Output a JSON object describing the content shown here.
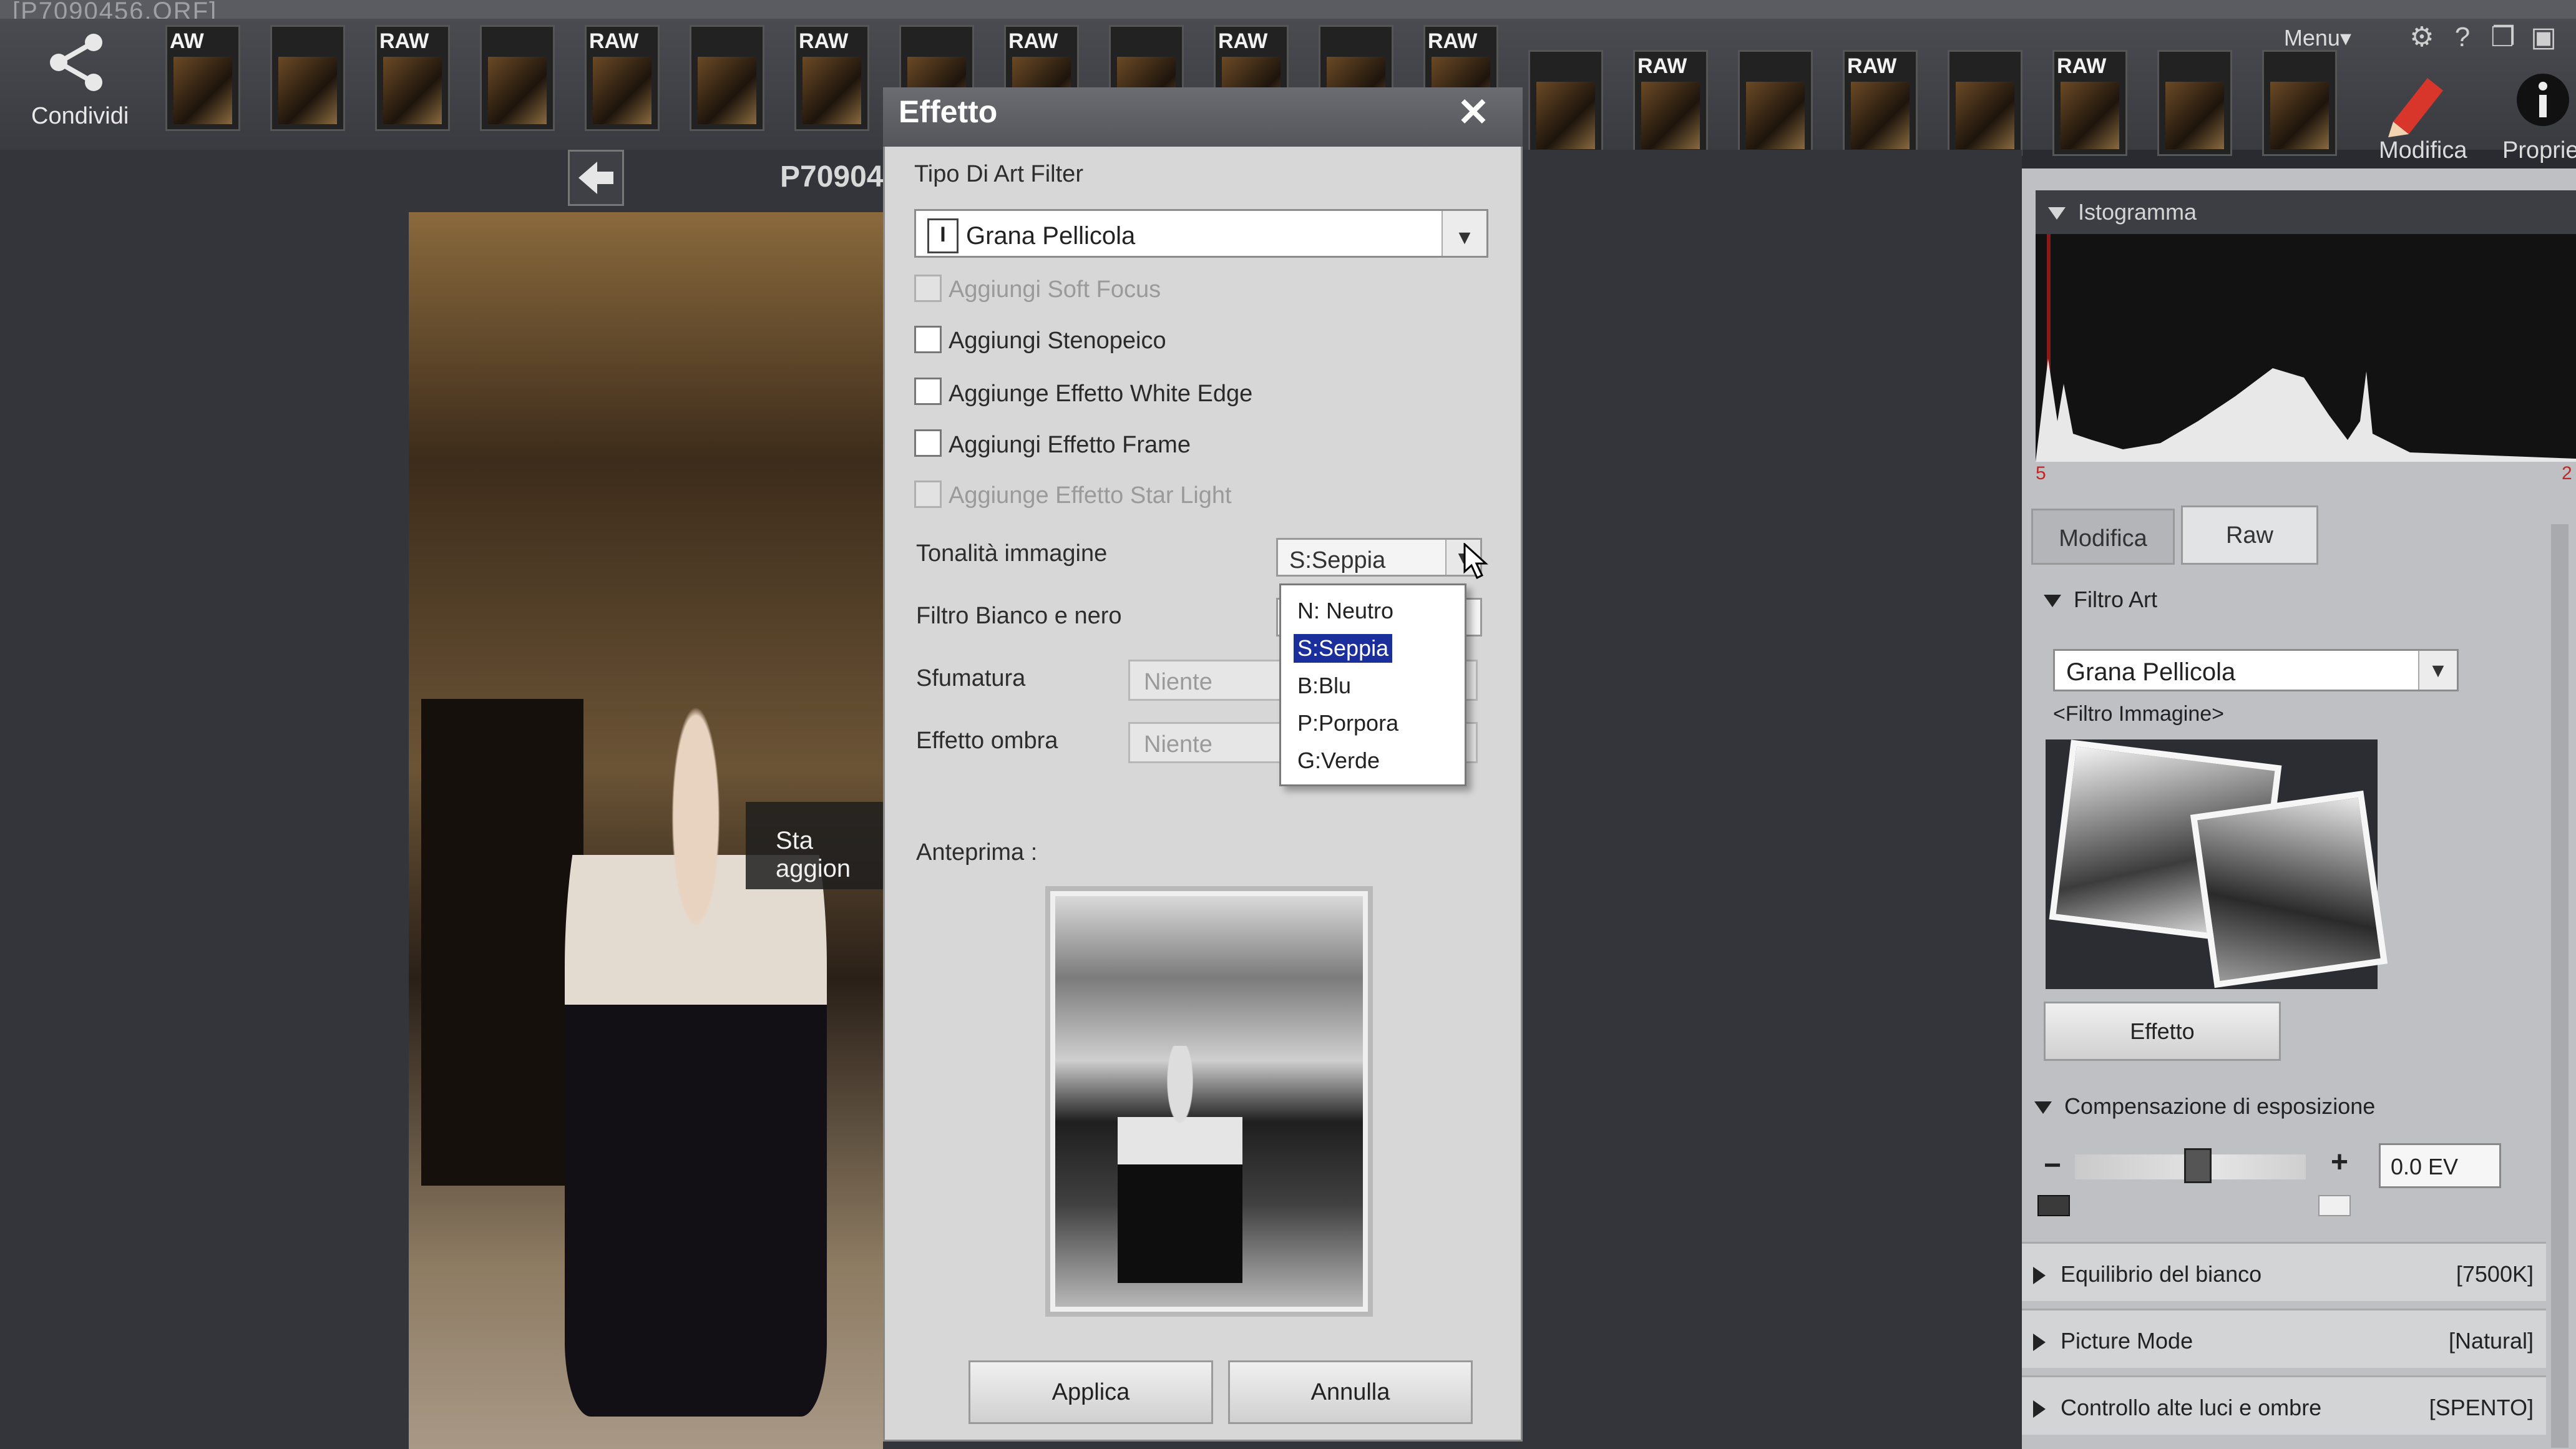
{
  "window": {
    "title_fragment": "[P7090456.ORF]"
  },
  "toolbar": {
    "share_label": "Condividi",
    "menu_label": "Menu▾",
    "edit_label": "Modifica",
    "properties_label": "Propriet",
    "thumbnails": [
      "AW",
      "",
      "RAW",
      "",
      "RAW",
      "",
      "RAW",
      "",
      "RAW",
      "",
      "RAW",
      "",
      "RAW",
      "",
      "RAW",
      "",
      "RAW",
      "",
      "RAW",
      "",
      ""
    ]
  },
  "viewer": {
    "filename": "P70904",
    "loading_text": "Sta aggion"
  },
  "dialog": {
    "title": "Effetto",
    "close_glyph": "✕",
    "art_filter_type_label": "Tipo Di Art Filter",
    "art_filter_value": "Grana Pellicola",
    "checkboxes": [
      {
        "label": "Aggiungi Soft Focus",
        "enabled": false,
        "checked": false
      },
      {
        "label": "Aggiungi Stenopeico",
        "enabled": true,
        "checked": false
      },
      {
        "label": "Aggiunge Effetto White Edge",
        "enabled": true,
        "checked": false
      },
      {
        "label": "Aggiungi Effetto Frame",
        "enabled": true,
        "checked": false
      },
      {
        "label": "Aggiunge Effetto Star Light",
        "enabled": false,
        "checked": false
      }
    ],
    "tonality_label": "Tonalità immagine",
    "tonality_value": "S:Seppia",
    "tonality_options": [
      "N: Neutro",
      "S:Seppia",
      "B:Blu",
      "P:Porpora",
      "G:Verde"
    ],
    "tonality_selected_index": 1,
    "bw_filter_label": "Filtro Bianco e nero",
    "shading_label": "Sfumatura",
    "shading_value": "Niente",
    "shadow_label": "Effetto ombra",
    "shadow_value": "Niente",
    "preview_label": "Anteprima :",
    "apply_label": "Applica",
    "cancel_label": "Annulla"
  },
  "panel": {
    "histogram_label": "Istogramma",
    "histogram_min": "5",
    "histogram_max": "2",
    "tabs": [
      {
        "label": "Modifica",
        "active": false
      },
      {
        "label": "Raw",
        "active": true
      }
    ],
    "art_filter_section": "Filtro Art",
    "art_filter_value": "Grana Pellicola",
    "image_filter_caption": "<Filtro Immagine>",
    "effect_button": "Effetto",
    "exposure_section": "Compensazione di esposizione",
    "minus": "−",
    "plus": "+",
    "exposure_value": "0.0 EV",
    "exposure_level": 0.5,
    "rows": [
      {
        "label": "Equilibrio del bianco",
        "value": "[7500K]"
      },
      {
        "label": "Picture Mode",
        "value": "[Natural]"
      },
      {
        "label": "Controllo alte luci e ombre",
        "value": "[SPENTO]"
      }
    ]
  },
  "colors": {
    "dialog_bg": "#d7d7d7",
    "selection": "#1a2e9c",
    "toolbar": "#4a4b50",
    "panel": "#bfc0c3"
  }
}
